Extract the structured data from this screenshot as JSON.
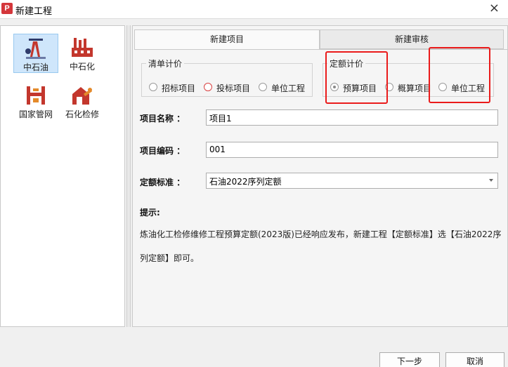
{
  "window": {
    "title": "新建工程",
    "icon": "app-logo-icon",
    "icon_letter": "P",
    "close_glyph": "×"
  },
  "categories": [
    {
      "name": "中石油",
      "icon": "oil-pump-icon",
      "selected": true
    },
    {
      "name": "中石化",
      "icon": "refinery-icon",
      "selected": false
    },
    {
      "name": "国家管网",
      "icon": "pipeline-icon",
      "selected": false
    },
    {
      "name": "石化检修",
      "icon": "maintenance-icon",
      "selected": false
    }
  ],
  "tabs": {
    "new_project": "新建项目",
    "new_review": "新建审核"
  },
  "bill_pricing": {
    "title": "清单计价",
    "options": [
      "招标项目",
      "投标项目",
      "单位工程"
    ]
  },
  "quota_pricing": {
    "title": "定额计价",
    "options": [
      "预算项目",
      "概算项目",
      "单位工程"
    ],
    "selected": "预算项目"
  },
  "form": {
    "name_label": "项目名称 ：",
    "name_value": "项目1",
    "code_label": "项目编码 ：",
    "code_value": "001",
    "standard_label": "定额标准 ：",
    "standard_value": "石油2022序列定额"
  },
  "hint": {
    "title": "提示:",
    "body": "炼油化工检修维修工程预算定额(2023版)已经响应发布，新建工程【定额标准】选【石油2022序列定额】即可。"
  },
  "buttons": {
    "next": "下一步",
    "cancel": "取消"
  },
  "colors": {
    "accent_red": "#ea1b1b",
    "brand_red": "#d4373b",
    "selected_bg": "#cfe6fb"
  }
}
